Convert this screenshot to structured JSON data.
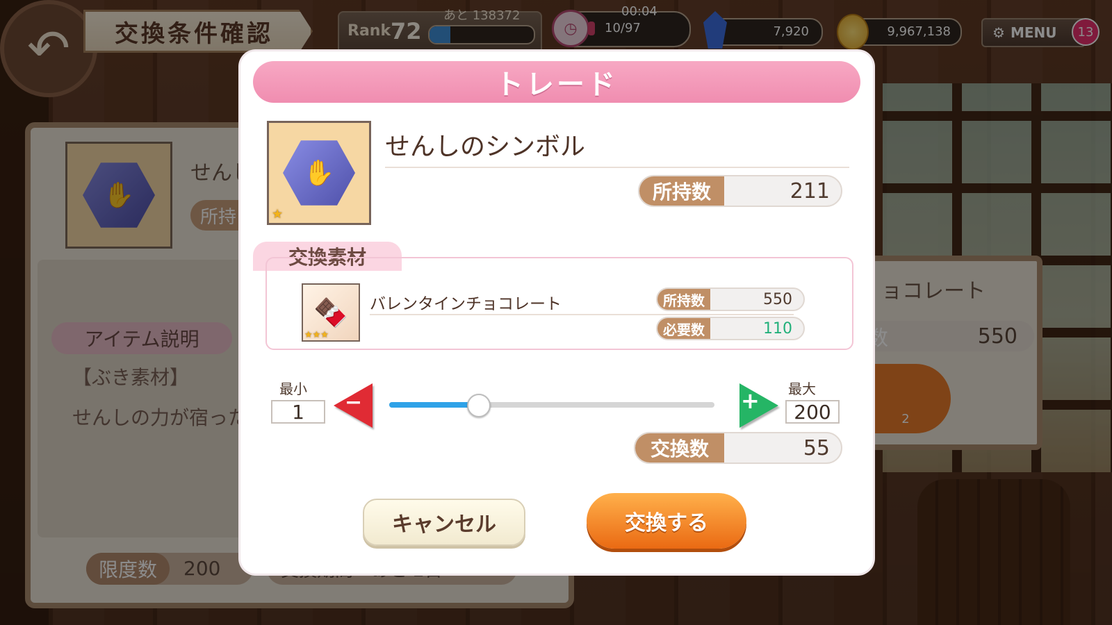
{
  "header": {
    "back_icon": "return-arrow-icon",
    "title": "交換条件確認",
    "rank_label": "Rank",
    "rank_value": "72",
    "exp_remaining": "あと 138372",
    "exp_progress": 0.2,
    "stamina_timer": "00:04",
    "stamina_value": "10/97",
    "stamina_progress": 0.1,
    "gems": "7,920",
    "gold": "9,967,138",
    "menu_label": "MENU",
    "menu_badge": "13"
  },
  "background_panel": {
    "item_name_partial": "せんし",
    "owned_label_partial": "所持",
    "desc_tab": "アイテム説明",
    "desc_head": "【ぶき素材】",
    "desc_text_partial": "せんしの力が宿った",
    "limit_label": "限度数",
    "limit_value": "200",
    "period_partial": "交換期間　あと 2日",
    "right_item_partial": "ョコレート",
    "right_owned_label_partial": "数",
    "right_owned_value": "550",
    "right_button_sub": "2"
  },
  "modal": {
    "title": "トレード",
    "item": {
      "name": "せんしのシンボル",
      "icon": "warrior-symbol-icon",
      "rarity_stars": 1,
      "owned_label": "所持数",
      "owned_value": "211"
    },
    "material": {
      "tab_label": "交換素材",
      "name": "バレンタインチョコレート",
      "icon": "valentine-chocolate-icon",
      "rarity_stars": 3,
      "owned_label": "所持数",
      "owned_value": "550",
      "required_label": "必要数",
      "required_value": "110"
    },
    "slider": {
      "min_label": "最小",
      "min_value": "1",
      "max_label": "最大",
      "max_value": "200",
      "current": 55
    },
    "exchange_count_label": "交換数",
    "exchange_count_value": "55",
    "cancel_label": "キャンセル",
    "confirm_label": "交換する"
  },
  "colors": {
    "title_pink": "#f08db0",
    "label_brown": "#c08f66",
    "slider_blue": "#2fa2e8",
    "minus_red": "#e02b34",
    "plus_green": "#25b565",
    "confirm_orange": "#ea6a13",
    "required_green": "#22b07a"
  }
}
